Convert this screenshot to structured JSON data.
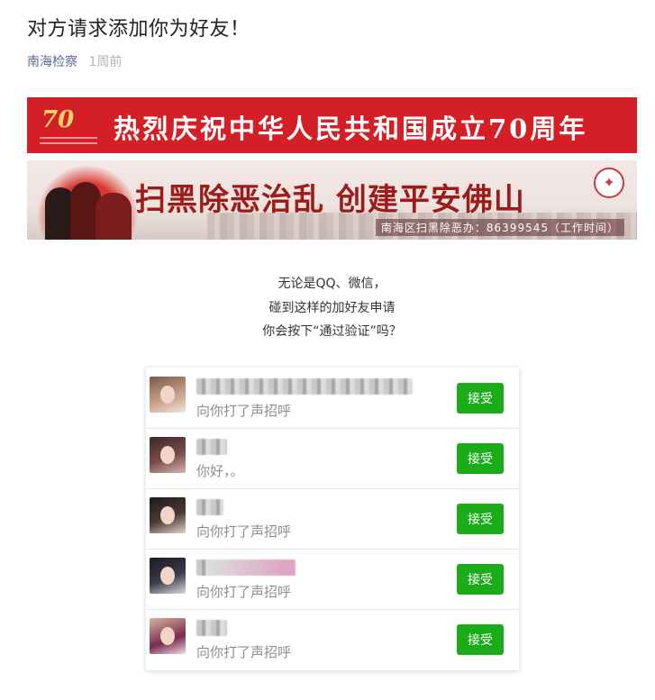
{
  "article": {
    "title": "对方请求添加你为好友！",
    "account": "南海检察",
    "time": "1周前"
  },
  "banner1": {
    "text": "热烈庆祝中华人民共和国成立70周年",
    "logo_number": "70",
    "color": "#d31f25"
  },
  "banner2": {
    "slogan": "扫黑除恶治乱  创建平安佛山",
    "contact": "南海区扫黑除恶办：86399545（工作时间）"
  },
  "intro": {
    "lines": [
      "无论是QQ、微信，",
      "碰到这样的加好友申请",
      "你会按下“通过验证”吗？"
    ]
  },
  "friend_requests": [
    {
      "message": "向你打了声招呼",
      "button": "接受"
    },
    {
      "message": "你好，。",
      "button": "接受"
    },
    {
      "message": "向你打了声招呼",
      "button": "接受"
    },
    {
      "message": "向你打了声招呼",
      "button": "接受"
    },
    {
      "message": "向你打了声招呼",
      "button": "接受"
    }
  ],
  "colors": {
    "accept_green": "#1aad19",
    "account_link": "#576b95"
  }
}
